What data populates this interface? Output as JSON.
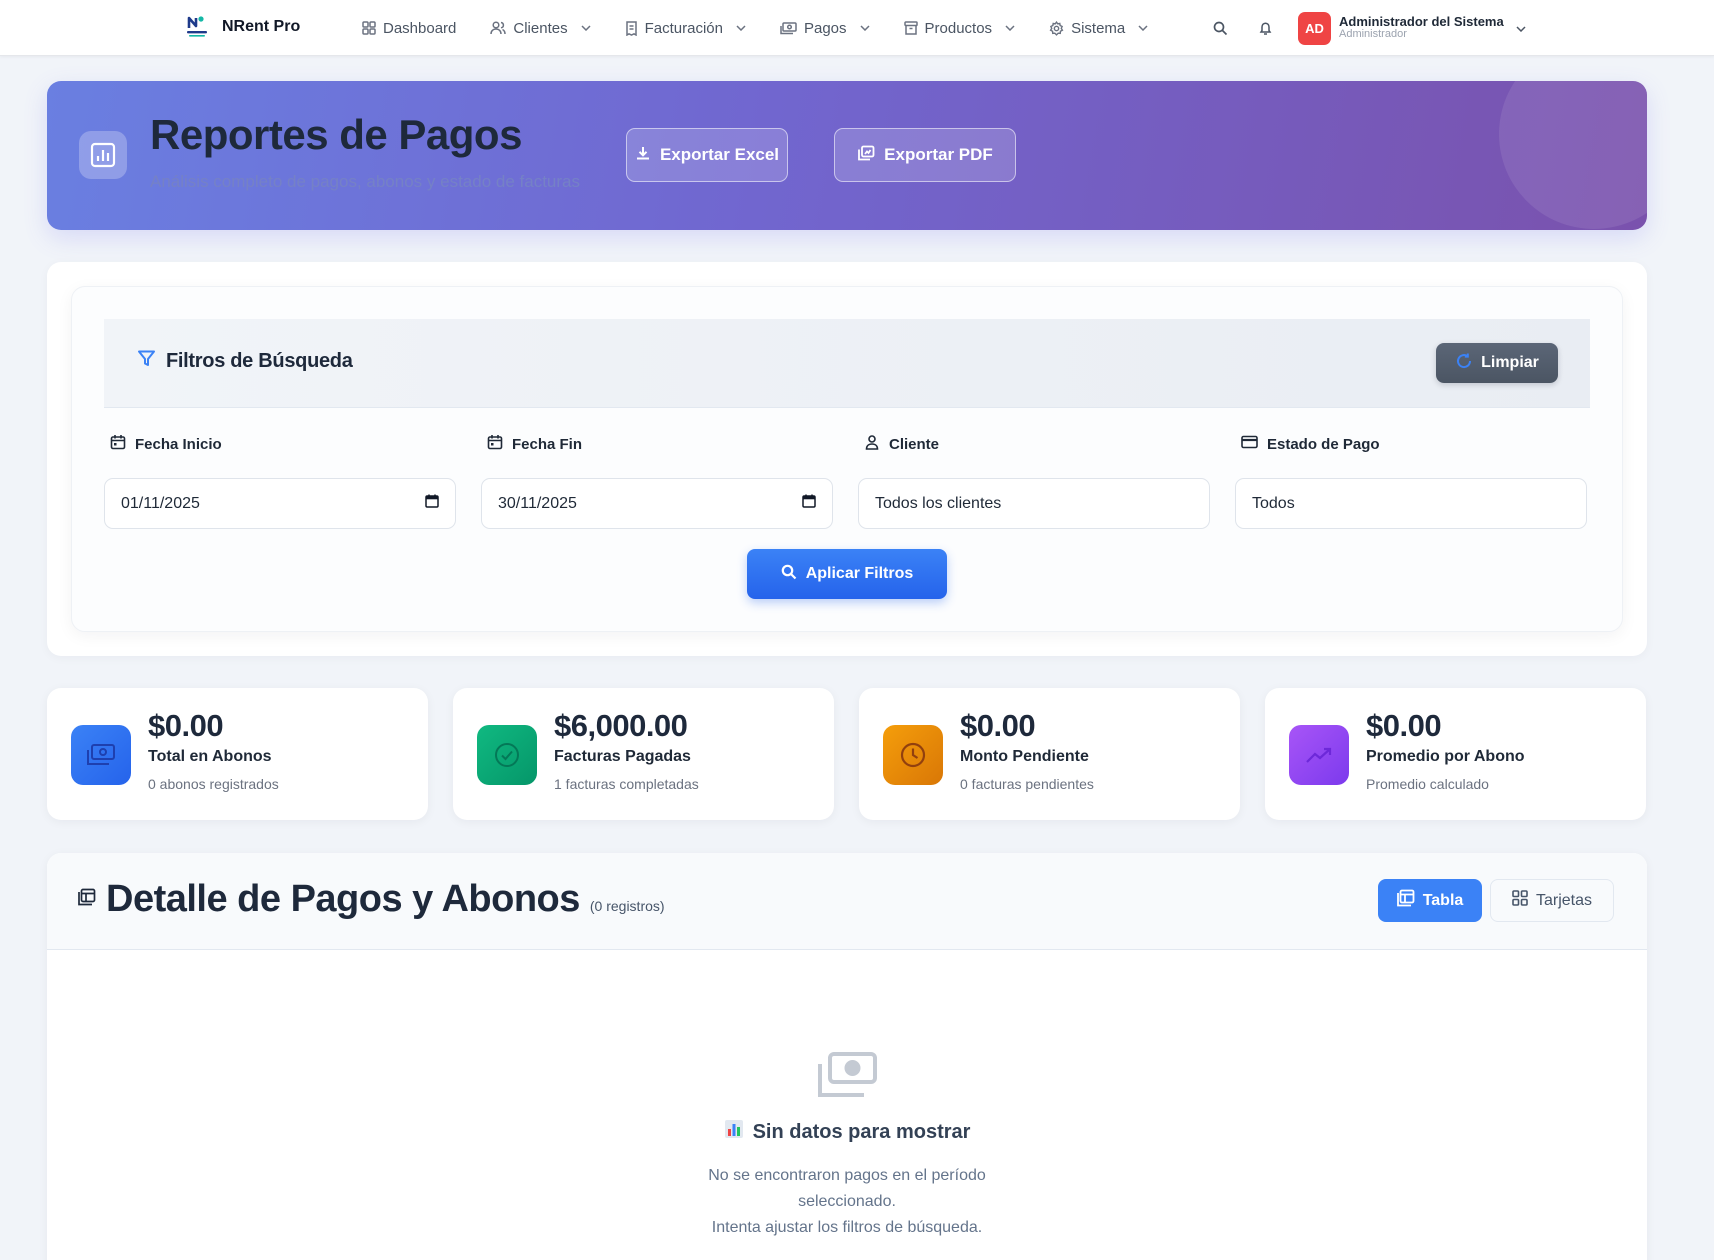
{
  "nav": {
    "brand": "NRent Pro",
    "items": [
      {
        "label": "Dashboard",
        "icon": "dashboard-icon",
        "dropdown": false
      },
      {
        "label": "Clientes",
        "icon": "users-icon",
        "dropdown": true
      },
      {
        "label": "Facturación",
        "icon": "invoice-icon",
        "dropdown": true
      },
      {
        "label": "Pagos",
        "icon": "cash-icon",
        "dropdown": true
      },
      {
        "label": "Productos",
        "icon": "box-icon",
        "dropdown": true
      },
      {
        "label": "Sistema",
        "icon": "gear-icon",
        "dropdown": true
      }
    ],
    "user": {
      "initials": "AD",
      "name": "Administrador del Sistema",
      "role": "Administrador"
    }
  },
  "hero": {
    "title": "Reportes de Pagos",
    "subtitle": "Análisis completo de pagos, abonos y estado de facturas",
    "export_excel": "Exportar Excel",
    "export_pdf": "Exportar PDF"
  },
  "filters": {
    "title": "Filtros de Búsqueda",
    "clear_label": "Limpiar",
    "fecha_inicio": {
      "label": "Fecha Inicio",
      "value": "01/11/2025"
    },
    "fecha_fin": {
      "label": "Fecha Fin",
      "value": "30/11/2025"
    },
    "cliente": {
      "label": "Cliente",
      "value": "Todos los clientes"
    },
    "estado": {
      "label": "Estado de Pago",
      "value": "Todos"
    },
    "apply_label": "Aplicar Filtros"
  },
  "stats": [
    {
      "value": "$0.00",
      "label": "Total en Abonos",
      "note": "0 abonos registrados",
      "color": "#3b82f6"
    },
    {
      "value": "$6,000.00",
      "label": "Facturas Pagadas",
      "note": "1 facturas completadas",
      "color": "#10b981"
    },
    {
      "value": "$0.00",
      "label": "Monto Pendiente",
      "note": "0 facturas pendientes",
      "color": "#f59e0b"
    },
    {
      "value": "$0.00",
      "label": "Promedio por Abono",
      "note": "Promedio calculado",
      "color": "#8b5cf6"
    }
  ],
  "detail": {
    "title": "Detalle de Pagos y Abonos",
    "count": "(0 registros)",
    "view_table": "Tabla",
    "view_cards": "Tarjetas",
    "empty_title": "Sin datos para mostrar",
    "empty_line1": "No se encontraron pagos en el período",
    "empty_line2": "seleccionado.",
    "empty_line3": "Intenta ajustar los filtros de búsqueda."
  }
}
